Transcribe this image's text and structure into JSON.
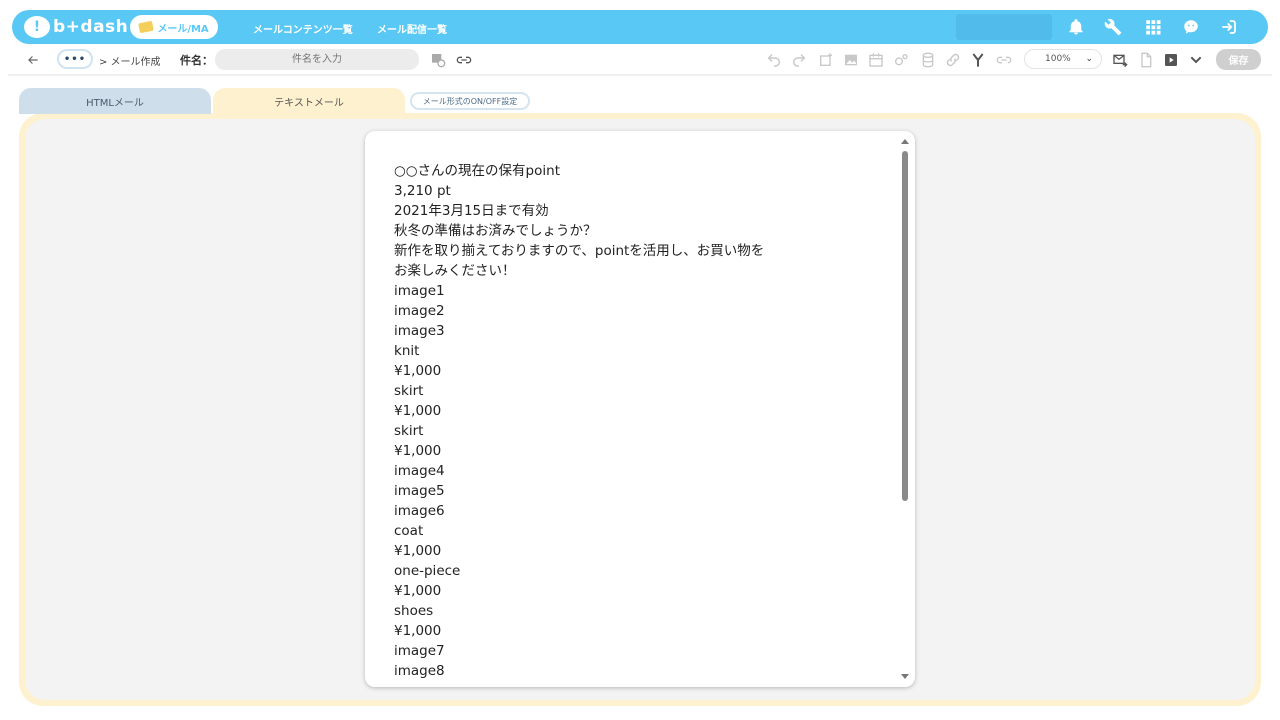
{
  "header": {
    "logo_text": "b+dash",
    "product_pill": "メール/MA",
    "nav_links": [
      "メールコンテンツ一覧",
      "メール配信一覧"
    ]
  },
  "toolbar": {
    "more_label": "•••",
    "breadcrumb": "> メール作成",
    "subject_label": "件名：",
    "subject_placeholder": "件名を入力",
    "zoom_value": "100%",
    "save_label": "保存"
  },
  "tabs": {
    "html_tab": "HTMLメール",
    "text_tab": "テキストメール",
    "format_toggle": "メール形式のON/OFF設定"
  },
  "editor": {
    "lines": [
      "○○さんの現在の保有point",
      "3,210 pt",
      "2021年3月15日まで有効",
      "秋冬の準備はお済みでしょうか？",
      "新作を取り揃えておりますので、pointを活用し、お買い物を",
      "お楽しみください！",
      "image1",
      "image2",
      "image3",
      "knit",
      "¥1,000",
      "skirt",
      "¥1,000",
      "skirt",
      "¥1,000",
      "image4",
      "image5",
      "image6",
      "coat",
      "¥1,000",
      "one-piece",
      "¥1,000",
      "shoes",
      "¥1,000",
      "image7",
      "image8"
    ]
  },
  "colors": {
    "brand": "#5ac8f5",
    "tab_html": "#cfdeeb",
    "tab_text": "#fdf1cf",
    "save_disabled": "#cfcfcf"
  },
  "icons": {
    "top": [
      "bell-icon",
      "wrench-icon",
      "grid-icon",
      "face-icon",
      "logout-icon"
    ],
    "toolbar": [
      "back-arrow-icon",
      "schedule-icon",
      "link-icon",
      "undo-icon",
      "redo-icon",
      "add-block-icon",
      "image-icon",
      "calendar-icon",
      "gears-icon",
      "database-icon",
      "chain-icon",
      "branch-icon",
      "link-lock-icon",
      "chevron-down-icon",
      "mail-send-icon",
      "document-icon",
      "play-icon",
      "expand-icon"
    ]
  }
}
